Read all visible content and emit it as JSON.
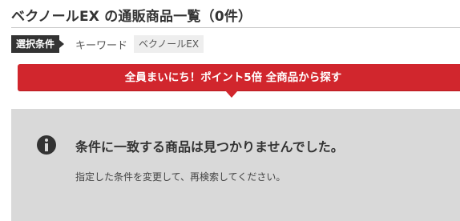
{
  "header": {
    "title": "ベクノールEX の通販商品一覧（0件）"
  },
  "conditions": {
    "tag_label": "選択条件",
    "key_label": "キーワード",
    "keyword": "ベクノールEX"
  },
  "promo": {
    "text": "全員まいにち！ポイント5倍 全商品から探す",
    "color": "#d1262d"
  },
  "empty_state": {
    "icon": "info-icon",
    "heading": "条件に一致する商品は見つかりませんでした。",
    "message": "指定した条件を変更して、再検索してください。"
  }
}
